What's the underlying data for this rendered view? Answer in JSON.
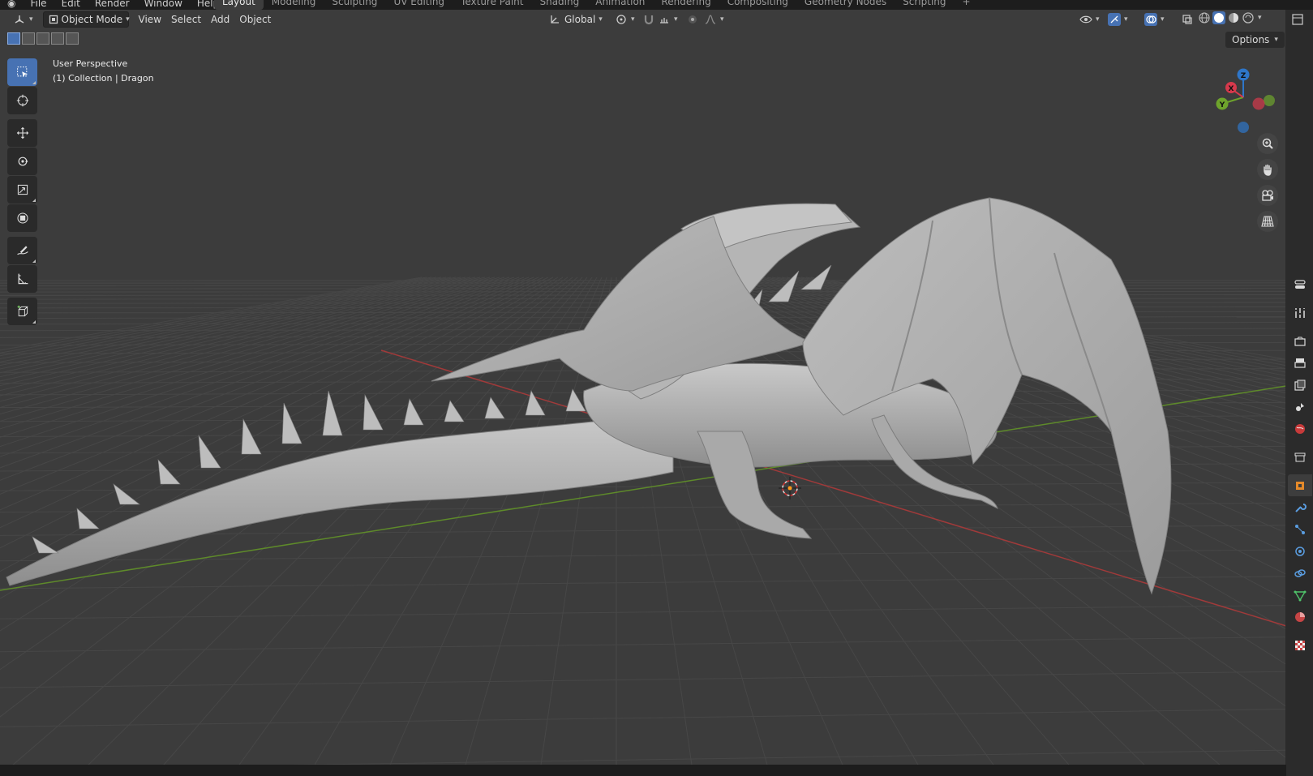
{
  "menubar": {
    "items": [
      "File",
      "Edit",
      "Render",
      "Window",
      "Help"
    ],
    "workspaces": [
      {
        "label": "Layout",
        "active": true
      },
      {
        "label": "Modeling",
        "active": false
      },
      {
        "label": "Sculpting",
        "active": false
      },
      {
        "label": "UV Editing",
        "active": false
      },
      {
        "label": "Texture Paint",
        "active": false
      },
      {
        "label": "Shading",
        "active": false
      },
      {
        "label": "Animation",
        "active": false
      },
      {
        "label": "Rendering",
        "active": false
      },
      {
        "label": "Compositing",
        "active": false
      },
      {
        "label": "Geometry Nodes",
        "active": false
      },
      {
        "label": "Scripting",
        "active": false
      }
    ],
    "add_workspace": "+"
  },
  "header": {
    "editor_type_icon": "3d-viewport-icon",
    "mode": "Object Mode",
    "menus": [
      "View",
      "Select",
      "Add",
      "Object"
    ],
    "transform_orientation": "Global",
    "pivot_icon": "pivot-icon",
    "snap_icon": "magnet-icon",
    "proportional_icon": "proportional-icon",
    "options_label": "Options"
  },
  "viewport": {
    "view_name": "User Perspective",
    "collection_info": "(1) Collection | Dragon",
    "object_name": "Dragon",
    "bg_color": "#3c3c3c",
    "grid_color": "#484848",
    "x_axis_color": "#a03a3a",
    "y_axis_color": "#5e8a2a"
  },
  "toolbar": {
    "tools": [
      {
        "name": "select-box",
        "icon": "select-box-icon",
        "active": true
      },
      {
        "name": "cursor",
        "icon": "cursor-icon",
        "active": false
      },
      {
        "name": "move",
        "icon": "move-icon",
        "active": false
      },
      {
        "name": "rotate",
        "icon": "rotate-icon",
        "active": false
      },
      {
        "name": "scale",
        "icon": "scale-icon",
        "active": false
      },
      {
        "name": "transform",
        "icon": "transform-icon",
        "active": false
      },
      {
        "name": "annotate",
        "icon": "annotate-icon",
        "active": false
      },
      {
        "name": "measure",
        "icon": "measure-icon",
        "active": false
      },
      {
        "name": "add-cube",
        "icon": "add-cube-icon",
        "active": false
      }
    ]
  },
  "gizmo": {
    "x_label": "X",
    "y_label": "Y",
    "z_label": "Z",
    "x_color": "#d6394c",
    "y_color": "#6ea42c",
    "z_color": "#2e76c9"
  },
  "properties_tabs": [
    "tool-icon",
    "render-icon",
    "output-icon",
    "view-layer-icon",
    "scene-icon",
    "world-icon",
    "collection-icon",
    "object-icon",
    "modifier-icon",
    "particles-icon",
    "physics-icon",
    "constraints-icon",
    "data-icon",
    "material-icon",
    "texture-icon"
  ]
}
